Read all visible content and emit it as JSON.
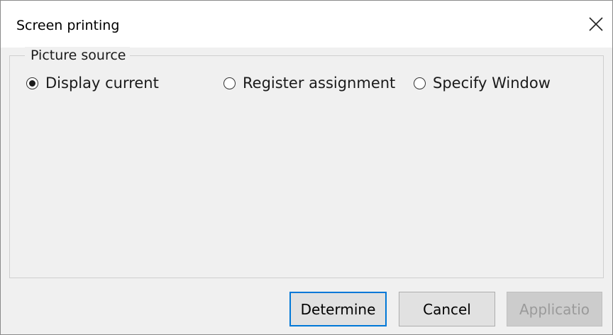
{
  "window": {
    "title": "Screen printing",
    "close_icon": "close-icon"
  },
  "picture_source": {
    "legend": "Picture source",
    "options": [
      {
        "label": "Display current",
        "checked": true
      },
      {
        "label": "Register assignment",
        "checked": false
      },
      {
        "label": "Specify Window",
        "checked": false
      }
    ]
  },
  "buttons": {
    "determine": "Determine",
    "cancel": "Cancel",
    "application": "Applicatio"
  },
  "colors": {
    "default_button_border": "#0078d7",
    "disabled_text": "#9a9a9a"
  }
}
